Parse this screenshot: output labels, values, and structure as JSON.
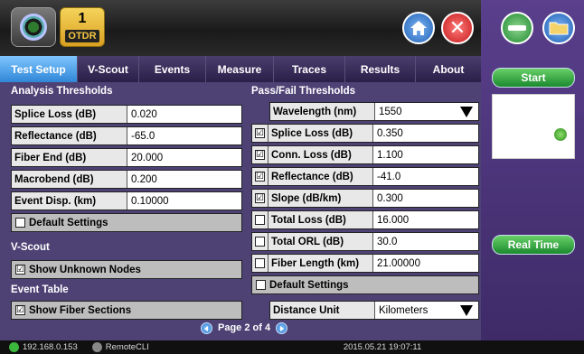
{
  "header": {
    "badge_number": "1",
    "badge_label": "OTDR",
    "close_glyph": "✕"
  },
  "tabs": [
    {
      "label": "Test Setup",
      "active": true
    },
    {
      "label": "V-Scout",
      "active": false
    },
    {
      "label": "Events",
      "active": false
    },
    {
      "label": "Measure",
      "active": false
    },
    {
      "label": "Traces",
      "active": false
    },
    {
      "label": "Results",
      "active": false
    },
    {
      "label": "About",
      "active": false
    }
  ],
  "analysis": {
    "title": "Analysis Thresholds",
    "rows": [
      {
        "label": "Splice Loss (dB)",
        "value": "0.020"
      },
      {
        "label": "Reflectance (dB)",
        "value": "-65.0"
      },
      {
        "label": "Fiber End (dB)",
        "value": "20.000"
      },
      {
        "label": "Macrobend (dB)",
        "value": "0.200"
      },
      {
        "label": "Event Disp. (km)",
        "value": "0.10000"
      }
    ],
    "default_settings": "Default Settings"
  },
  "vscout": {
    "title": "V-Scout",
    "show_unknown_nodes": "Show Unknown Nodes"
  },
  "event_table": {
    "title": "Event Table",
    "show_fiber_sections": "Show Fiber Sections"
  },
  "passfail": {
    "title": "Pass/Fail Thresholds",
    "wavelength_label": "Wavelength (nm)",
    "wavelength_value": "1550",
    "rows": [
      {
        "label": "Splice Loss (dB)",
        "value": "0.350",
        "checked": true
      },
      {
        "label": "Conn. Loss (dB)",
        "value": "1.100",
        "checked": true
      },
      {
        "label": "Reflectance (dB)",
        "value": "-41.0",
        "checked": true
      },
      {
        "label": "Slope (dB/km)",
        "value": "0.300",
        "checked": true
      },
      {
        "label": "Total Loss (dB)",
        "value": "16.000",
        "checked": false
      },
      {
        "label": "Total ORL (dB)",
        "value": "30.0",
        "checked": false
      },
      {
        "label": "Fiber Length (km)",
        "value": "21.00000",
        "checked": false
      }
    ],
    "default_settings": "Default Settings"
  },
  "distance": {
    "label": "Distance Unit",
    "value": "Kilometers"
  },
  "pager": {
    "text": "Page 2 of 4"
  },
  "side": {
    "start_label": "Start",
    "realtime_label": "Real Time"
  },
  "status": {
    "ip": "192.168.0.153",
    "remote": "RemoteCLI",
    "datetime": "2015.05.21 19:07:11"
  },
  "check_glyph": "☑"
}
